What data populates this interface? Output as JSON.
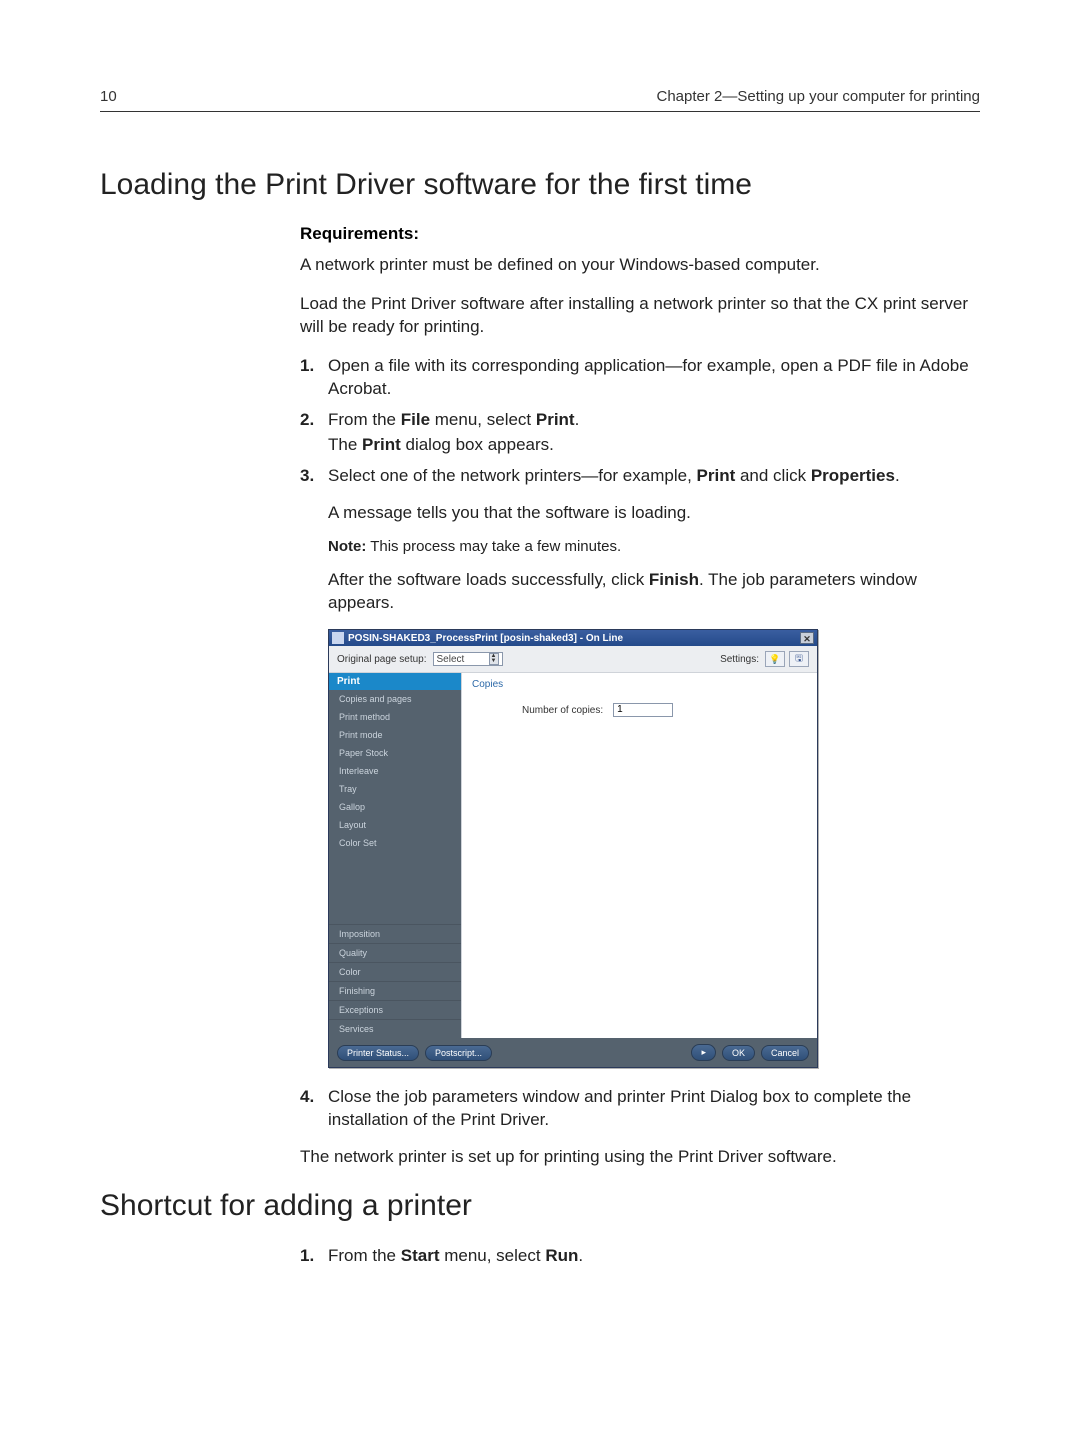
{
  "header": {
    "page_number": "10",
    "chapter_line": "Chapter 2—Setting up your computer for printing"
  },
  "section1": {
    "heading": "Loading the Print Driver software for the first time",
    "req_label": "Requirements:",
    "req_text": "A network printer must be defined on your Windows-based computer.",
    "intro_text": "Load the Print Driver software after installing a network printer so that the CX print server will be ready for printing.",
    "step1_a": "Open a file with its corresponding application—for example, open a PDF file in Adobe Acrobat.",
    "step2_a": "From the ",
    "step2_b": "File",
    "step2_c": " menu, select ",
    "step2_d": "Print",
    "step2_e": ".",
    "step2_sub_a": "The ",
    "step2_sub_b": "Print",
    "step2_sub_c": " dialog box appears.",
    "step3_a": "Select one of the network printers—for example, ",
    "step3_b": "Print",
    "step3_c": " and click ",
    "step3_d": "Properties",
    "step3_e": ".",
    "step3_msg": "A message tells you that the software is loading.",
    "note_label": "Note:",
    "note_text": " This process may take a few minutes.",
    "after_a": "After the software loads successfully, click ",
    "after_b": "Finish",
    "after_c": ". The job parameters window appears.",
    "step4_text": "Close the job parameters window and printer Print Dialog box to complete the installation of the Print Driver.",
    "closing": "The network printer is set up for printing using the Print Driver software."
  },
  "section2": {
    "heading": "Shortcut for adding a printer",
    "step1_a": "From the ",
    "step1_b": "Start",
    "step1_c": " menu, select ",
    "step1_d": "Run",
    "step1_e": "."
  },
  "dialog": {
    "title": "POSIN-SHAKED3_ProcessPrint [posin-shaked3] - On Line",
    "topbar_label": "Original page setup:",
    "select_value": "Select",
    "settings_label": "Settings:",
    "panel_title": "Copies",
    "copies_label": "Number of copies:",
    "copies_value": "1",
    "side_header": "Print",
    "side_items": [
      "Copies and pages",
      "Print method",
      "Print mode",
      "Paper Stock",
      "Interleave",
      "Tray",
      "Gallop",
      "Layout",
      "Color Set"
    ],
    "other_groups": [
      "Imposition",
      "Quality",
      "Color",
      "Finishing",
      "Exceptions",
      "Services"
    ],
    "footer": {
      "printer_status": "Printer Status...",
      "postscript": "Postscript...",
      "arrow": "▸",
      "ok": "OK",
      "cancel": "Cancel"
    }
  }
}
